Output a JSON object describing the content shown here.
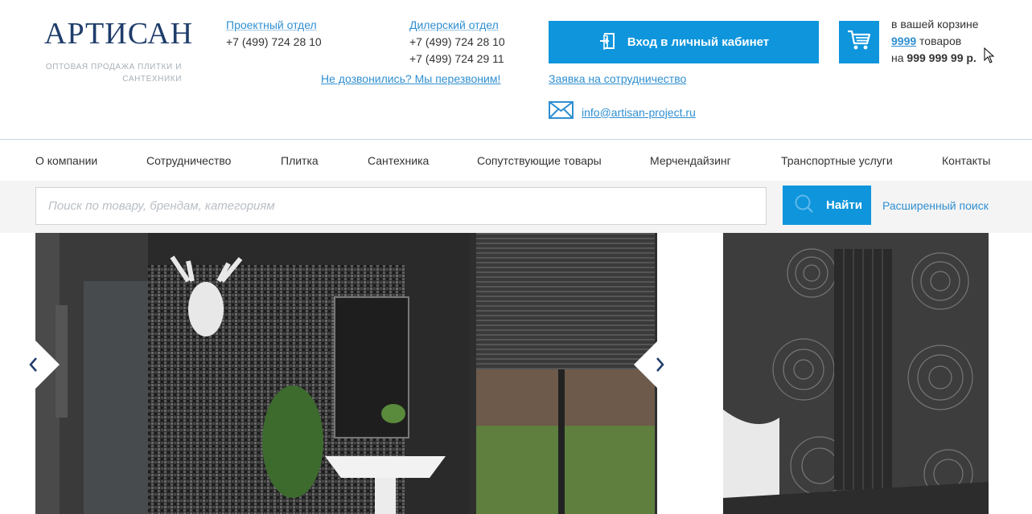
{
  "logo": {
    "name": "АРТИСАН",
    "tagline_line1": "ОПТОВАЯ ПРОДАЖА ПЛИТКИ И",
    "tagline_line2": "САНТЕХНИКИ"
  },
  "contacts": {
    "project_dept": {
      "title": "Проектный отдел",
      "phone": "+7 (499) 724 28 10"
    },
    "dealer_dept": {
      "title": "Дилерский отдел",
      "phone1": "+7 (499) 724 28 10",
      "phone2": "+7 (499) 724 29 11"
    },
    "callback_link": "Не дозвонились? Мы перезвоним!"
  },
  "account": {
    "login_label": "Вход в личный кабинет",
    "cooperation_link": "Заявка на сотрудничество",
    "email": "info@artisan-project.ru"
  },
  "cart": {
    "line1": "в вашей корзине",
    "count": "9999",
    "count_suffix": " товаров",
    "sum_prefix": "на ",
    "sum": "999 999 99 р."
  },
  "nav": {
    "items": [
      {
        "label": "О компании"
      },
      {
        "label": "Сотрудничество"
      },
      {
        "label": "Плитка"
      },
      {
        "label": "Сантехника"
      },
      {
        "label": "Сопутствующие товары"
      },
      {
        "label": "Мерчендайзинг"
      },
      {
        "label": "Транспортные услуги"
      },
      {
        "label": "Контакты"
      }
    ]
  },
  "search": {
    "placeholder": "Поиск по товару, брендам, категориям",
    "button_label": "Найти",
    "advanced_label": "Расширенный поиск"
  },
  "colors": {
    "accent": "#0e95dc",
    "link": "#2f8fd1",
    "logo": "#1f3d6b"
  }
}
